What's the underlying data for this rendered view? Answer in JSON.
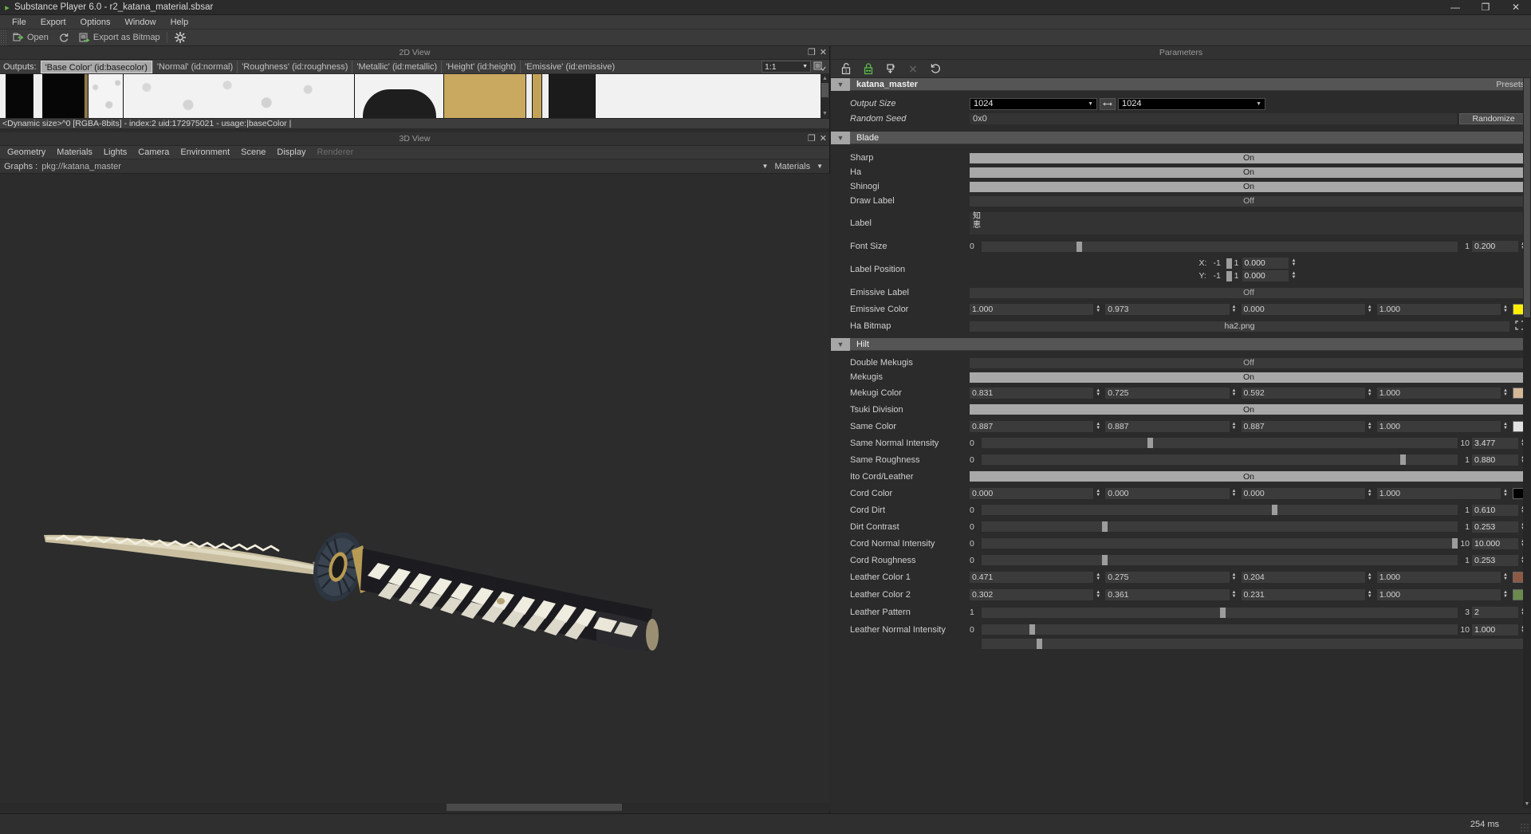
{
  "window": {
    "title": "Substance Player 6.0 - r2_katana_material.sbsar",
    "minimize": "—",
    "maximize": "❐",
    "close": "✕"
  },
  "menubar": [
    "File",
    "Export",
    "Options",
    "Window",
    "Help"
  ],
  "toolbar": {
    "open": "Open",
    "export_as_bitmap": "Export as Bitmap",
    "refresh_icon": "refresh-icon",
    "settings_icon": "gear-icon"
  },
  "view2d": {
    "title": "2D View",
    "undock": "❐",
    "close": "✕",
    "outputs_label": "Outputs:",
    "tabs": [
      {
        "label": "'Base Color' (id:basecolor)",
        "active": true
      },
      {
        "label": "'Normal' (id:normal)",
        "active": false
      },
      {
        "label": "'Roughness' (id:roughness)",
        "active": false
      },
      {
        "label": "'Metallic' (id:metallic)",
        "active": false
      },
      {
        "label": "'Height' (id:height)",
        "active": false
      },
      {
        "label": "'Emissive' (id:emissive)",
        "active": false
      }
    ],
    "zoom_level": "1:1",
    "status": "<Dynamic size>^0 [RGBA-8bits]  - index:2 uid:172975021 - usage:|baseColor |"
  },
  "view3d": {
    "title": "3D View",
    "undock": "❐",
    "close": "✕",
    "menu": [
      {
        "label": "Geometry",
        "dim": false
      },
      {
        "label": "Materials",
        "dim": false
      },
      {
        "label": "Lights",
        "dim": false
      },
      {
        "label": "Camera",
        "dim": false
      },
      {
        "label": "Environment",
        "dim": false
      },
      {
        "label": "Scene",
        "dim": false
      },
      {
        "label": "Display",
        "dim": false
      },
      {
        "label": "Renderer",
        "dim": true
      }
    ],
    "graphs_label": "Graphs :",
    "graphs_path": "pkg://katana_master",
    "materials_label": "Materials"
  },
  "parameters": {
    "title": "Parameters",
    "tools": [
      "unlock-icon",
      "link-icon",
      "pin-icon",
      "x-icon",
      "reset-icon"
    ],
    "presets_label": "Presets",
    "groups": [
      {
        "name": "katana_master",
        "bold": true,
        "rows": [
          {
            "type": "combo2",
            "label": "Output Size",
            "italic": true,
            "value_left": "1024",
            "value_right": "1024",
            "link_icon": "link-icon"
          },
          {
            "type": "text",
            "label": "Random Seed",
            "italic": true,
            "value": "0x0",
            "button": "Randomize"
          }
        ]
      },
      {
        "name": "Blade",
        "bold": false,
        "rows": [
          {
            "type": "toggle",
            "label": "Sharp",
            "state": "On"
          },
          {
            "type": "toggle",
            "label": "Ha",
            "state": "On"
          },
          {
            "type": "toggle",
            "label": "Shinogi",
            "state": "On"
          },
          {
            "type": "toggle",
            "label": "Draw Label",
            "state": "Off"
          },
          {
            "type": "multiline",
            "label": "Label",
            "value": "知\n恵"
          },
          {
            "type": "slider",
            "label": "Font Size",
            "min": "0",
            "max": "1",
            "value": "0.200",
            "fill": 0.2
          },
          {
            "type": "xy",
            "label": "Label Position",
            "x": {
              "axis": "X:",
              "min": "-1",
              "max": "1",
              "value": "0.000",
              "fill": 0.5
            },
            "y": {
              "axis": "Y:",
              "min": "-1",
              "max": "1",
              "value": "0.000",
              "fill": 0.5
            }
          },
          {
            "type": "toggle",
            "label": "Emissive Label",
            "state": "Off"
          },
          {
            "type": "color",
            "label": "Emissive Color",
            "values": [
              "1.000",
              "0.973",
              "0.000",
              "1.000"
            ],
            "swatch": "#ffee00"
          },
          {
            "type": "bitmap",
            "label": "Ha Bitmap",
            "value": "ha2.png"
          }
        ]
      },
      {
        "name": "Hilt",
        "bold": false,
        "rows": [
          {
            "type": "toggle",
            "label": "Double Mekugis",
            "state": "Off"
          },
          {
            "type": "toggle",
            "label": "Mekugis",
            "state": "On"
          },
          {
            "type": "color",
            "label": "Mekugi Color",
            "values": [
              "0.831",
              "0.725",
              "0.592",
              "1.000"
            ],
            "swatch": "#d4b997"
          },
          {
            "type": "toggle",
            "label": "Tsuki Division",
            "state": "On"
          },
          {
            "type": "color",
            "label": "Same Color",
            "values": [
              "0.887",
              "0.887",
              "0.887",
              "1.000"
            ],
            "swatch": "#e2e2e2"
          },
          {
            "type": "slider",
            "label": "Same Normal Intensity",
            "min": "0",
            "max": "10",
            "value": "3.477",
            "fill": 0.348
          },
          {
            "type": "slider",
            "label": "Same Roughness",
            "min": "0",
            "max": "1",
            "value": "0.880",
            "fill": 0.88
          },
          {
            "type": "toggle",
            "label": "Ito Cord/Leather",
            "state": "On"
          },
          {
            "type": "color",
            "label": "Cord Color",
            "values": [
              "0.000",
              "0.000",
              "0.000",
              "1.000"
            ],
            "swatch": "#000000"
          },
          {
            "type": "slider",
            "label": "Cord Dirt",
            "min": "0",
            "max": "1",
            "value": "0.610",
            "fill": 0.61
          },
          {
            "type": "slider",
            "label": "Dirt Contrast",
            "min": "0",
            "max": "1",
            "value": "0.253",
            "fill": 0.253
          },
          {
            "type": "slider",
            "label": "Cord Normal Intensity",
            "min": "0",
            "max": "10",
            "value": "10.000",
            "fill": 1.0
          },
          {
            "type": "slider",
            "label": "Cord Roughness",
            "min": "0",
            "max": "1",
            "value": "0.253",
            "fill": 0.253
          },
          {
            "type": "color",
            "label": "Leather Color 1",
            "values": [
              "0.471",
              "0.275",
              "0.204",
              "1.000"
            ],
            "swatch": "#8d5a46"
          },
          {
            "type": "color",
            "label": "Leather Color 2",
            "values": [
              "0.302",
              "0.361",
              "0.231",
              "1.000"
            ],
            "swatch": "#6b8a4d"
          },
          {
            "type": "slider",
            "label": "Leather Pattern",
            "min": "1",
            "max": "3",
            "value": "2",
            "fill": 0.5
          },
          {
            "type": "slider",
            "label": "Leather Normal Intensity",
            "min": "0",
            "max": "10",
            "value": "1.000",
            "fill": 0.1
          }
        ]
      }
    ]
  },
  "statusbar": {
    "render_time": "254 ms"
  }
}
